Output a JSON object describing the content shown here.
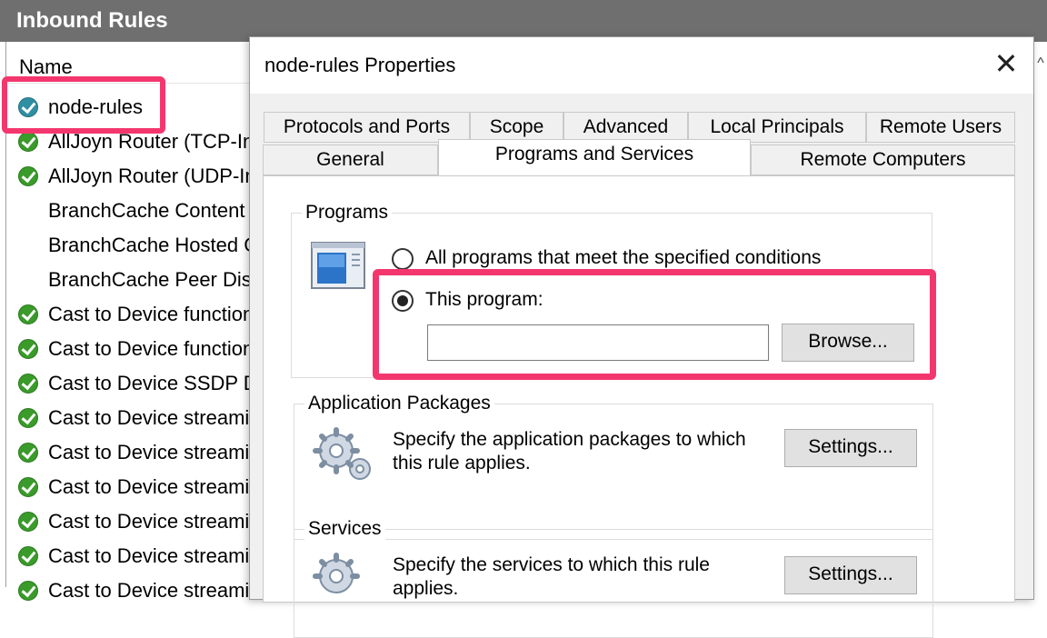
{
  "background": {
    "title": "Inbound Rules",
    "column_header": "Name",
    "rules": [
      {
        "label": "node-rules",
        "icon": "enabled-check-icon",
        "selected": true
      },
      {
        "label": "AllJoyn Router (TCP-In)",
        "icon": "enabled-check-icon"
      },
      {
        "label": "AllJoyn Router (UDP-In)",
        "icon": "enabled-check-icon"
      },
      {
        "label": "BranchCache Content Retrieval",
        "icon": ""
      },
      {
        "label": "BranchCache Hosted Cache Server",
        "icon": ""
      },
      {
        "label": "BranchCache Peer Discovery",
        "icon": ""
      },
      {
        "label": "Cast to Device functionality",
        "icon": "enabled-check-icon"
      },
      {
        "label": "Cast to Device functionality",
        "icon": "enabled-check-icon"
      },
      {
        "label": "Cast to Device SSDP Discovery",
        "icon": "enabled-check-icon"
      },
      {
        "label": "Cast to Device streaming server",
        "icon": "enabled-check-icon"
      },
      {
        "label": "Cast to Device streaming server",
        "icon": "enabled-check-icon"
      },
      {
        "label": "Cast to Device streaming server",
        "icon": "enabled-check-icon"
      },
      {
        "label": "Cast to Device streaming server",
        "icon": "enabled-check-icon"
      },
      {
        "label": "Cast to Device streaming server",
        "icon": "enabled-check-icon"
      },
      {
        "label": "Cast to Device streaming server",
        "icon": "enabled-check-icon"
      }
    ]
  },
  "dialog": {
    "title": "node-rules Properties",
    "close_icon": "close-icon",
    "tabs_row1": [
      "Protocols and Ports",
      "Scope",
      "Advanced",
      "Local Principals",
      "Remote Users"
    ],
    "tabs_row2": [
      "General",
      "Programs and Services",
      "Remote Computers"
    ],
    "active_tab": "Programs and Services",
    "programs": {
      "group_label": "Programs",
      "icon": "program-window-icon",
      "option_all": "All programs that meet the specified conditions",
      "option_this": "This program:",
      "selected": "this",
      "program_path": "",
      "browse_label": "Browse..."
    },
    "app_packages": {
      "group_label": "Application Packages",
      "icon": "gears-icon",
      "description": "Specify the application packages to which this rule applies.",
      "settings_label": "Settings..."
    },
    "services": {
      "group_label": "Services",
      "icon": "gears-icon",
      "description": "Specify the services to which this rule applies.",
      "settings_label": "Settings..."
    }
  },
  "colors": {
    "highlight": "#f3376e",
    "title_bar": "#6f6f6f",
    "check_green": "#3a9a2a"
  }
}
